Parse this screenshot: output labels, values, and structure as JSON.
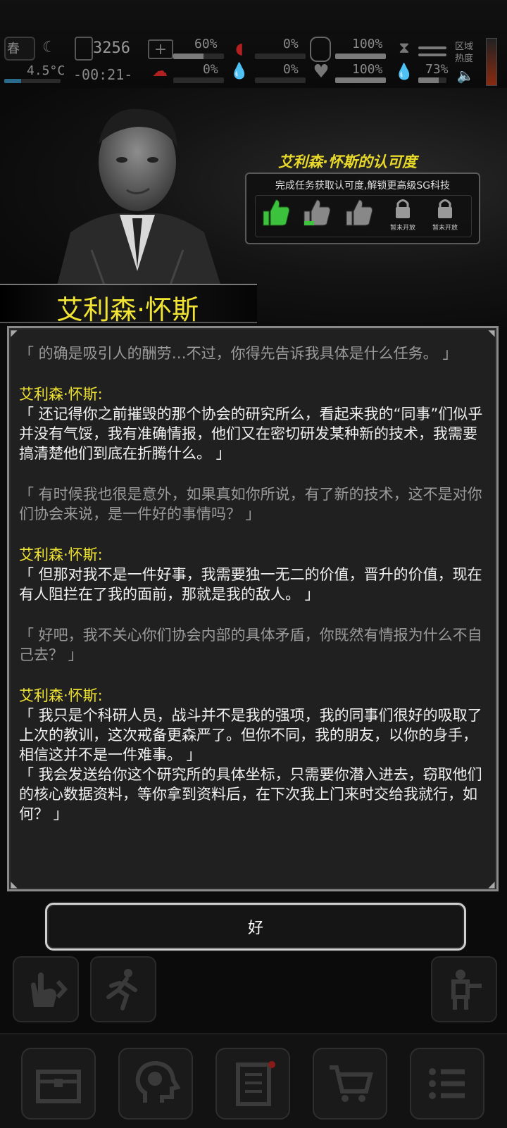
{
  "status": {
    "season": "春",
    "money": "3256",
    "temperature": "4.5°C",
    "time": "-00:21-",
    "health_pct": "60%",
    "blood_pct": "0%",
    "stat3_pct": "0%",
    "stat4_pct": "0%",
    "stomach_pct": "100%",
    "heart_pct": "100%",
    "stat7_pct": "73%",
    "zone_heat_label": "区域热度",
    "health_level": 0.6,
    "stomach_level": 1.0,
    "heart_level": 1.0,
    "stat7_level": 0.73
  },
  "npc": {
    "name": "艾利森·怀斯"
  },
  "approval": {
    "title": "艾利森·怀斯的认可度",
    "subtitle": "完成任务获取认可度,解锁更高级SG科技",
    "locked_label_1": "暂未开放",
    "locked_label_2": "暂未开放"
  },
  "dialog": {
    "e1": "「 的确是吸引人的酬劳…不过，你得先告诉我具体是什么任务。 」",
    "s2": "艾利森·怀斯:",
    "e2": "「 还记得你之前摧毁的那个协会的研究所么，看起来我的“同事”们似乎并没有气馁，我有准确情报，他们又在密切研发某种新的技术，我需要搞清楚他们到底在折腾什么。 」",
    "e3": "「 有时候我也很是意外，如果真如你所说，有了新的技术，这不是对你们协会来说，是一件好的事情吗？ 」",
    "s4": "艾利森·怀斯:",
    "e4": "「 但那对我不是一件好事，我需要独一无二的价值，晋升的价值，现在有人阻拦在了我的面前，那就是我的敌人。 」",
    "e5": "「 好吧，我不关心你们协会内部的具体矛盾，你既然有情报为什么不自己去？ 」",
    "s6": "艾利森·怀斯:",
    "e6a": "「 我只是个科研人员，战斗并不是我的强项，我的同事们很好的吸取了上次的教训，这次戒备更森严了。但你不同，我的朋友，以你的身手，相信这并不是一件难事。 」",
    "e6b": "「 我会发送给你这个研究所的具体坐标，只需要你潜入进去，窃取他们的核心数据资料，等你拿到资料后，在下次我上门来时交给我就行，如何？ 」"
  },
  "confirm_label": "好",
  "colors": {
    "speaker": "#f1e432",
    "npc_text": "#f0f0f0",
    "player_text": "#9a9a9a",
    "thumb_active": "#3cc23c"
  }
}
